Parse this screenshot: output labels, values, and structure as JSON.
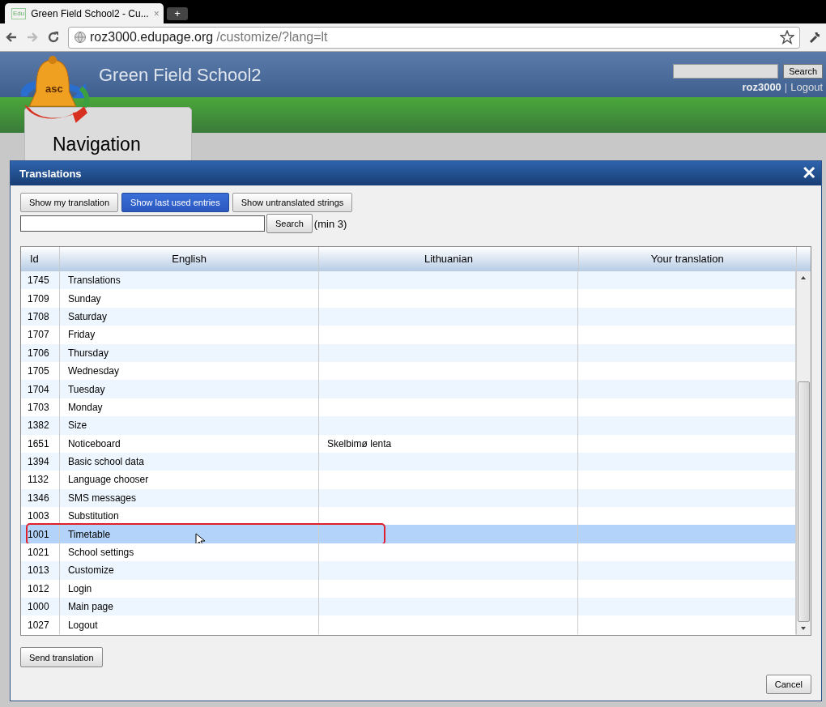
{
  "browser": {
    "tab_title": "Green Field School2 - Cu...",
    "tab_favicon": "Edu",
    "tab_close": "×",
    "new_tab": "+",
    "address_host": "roz3000.edupage.org",
    "address_path": "/customize/?lang=lt"
  },
  "site": {
    "logo_text": "asc",
    "title": "Green Field School2",
    "search_button": "Search",
    "user": "roz3000",
    "separator": "|",
    "logout": "Logout",
    "nav_tab": "Navigation"
  },
  "dialog": {
    "title": "Translations",
    "close": "✕",
    "filters": [
      {
        "label": "Show my translation",
        "selected": false
      },
      {
        "label": "Show last used entries",
        "selected": true
      },
      {
        "label": "Show untranslated strings",
        "selected": false
      }
    ],
    "search_button": "Search",
    "search_hint": "(min 3)",
    "table": {
      "columns": [
        "Id",
        "English",
        "Lithuanian",
        "Your translation"
      ],
      "rows": [
        {
          "id": "1745",
          "english": "Translations",
          "lithuanian": "",
          "selected": false
        },
        {
          "id": "1709",
          "english": "Sunday",
          "lithuanian": "",
          "selected": false
        },
        {
          "id": "1708",
          "english": "Saturday",
          "lithuanian": "",
          "selected": false
        },
        {
          "id": "1707",
          "english": "Friday",
          "lithuanian": "",
          "selected": false
        },
        {
          "id": "1706",
          "english": "Thursday",
          "lithuanian": "",
          "selected": false
        },
        {
          "id": "1705",
          "english": "Wednesday",
          "lithuanian": "",
          "selected": false
        },
        {
          "id": "1704",
          "english": "Tuesday",
          "lithuanian": "",
          "selected": false
        },
        {
          "id": "1703",
          "english": "Monday",
          "lithuanian": "",
          "selected": false
        },
        {
          "id": "1382",
          "english": "Size",
          "lithuanian": "",
          "selected": false
        },
        {
          "id": "1651",
          "english": "Noticeboard",
          "lithuanian": "Skelbimø lenta",
          "selected": false
        },
        {
          "id": "1394",
          "english": "Basic school data",
          "lithuanian": "",
          "selected": false
        },
        {
          "id": "1132",
          "english": "Language chooser",
          "lithuanian": "",
          "selected": false
        },
        {
          "id": "1346",
          "english": "SMS messages",
          "lithuanian": "",
          "selected": false
        },
        {
          "id": "1003",
          "english": "Substitution",
          "lithuanian": "",
          "selected": false
        },
        {
          "id": "1001",
          "english": "Timetable",
          "lithuanian": "",
          "selected": true
        },
        {
          "id": "1021",
          "english": "School settings",
          "lithuanian": "",
          "selected": false
        },
        {
          "id": "1013",
          "english": "Customize",
          "lithuanian": "",
          "selected": false
        },
        {
          "id": "1012",
          "english": "Login",
          "lithuanian": "",
          "selected": false
        },
        {
          "id": "1000",
          "english": "Main page",
          "lithuanian": "",
          "selected": false
        },
        {
          "id": "1027",
          "english": "Logout",
          "lithuanian": "",
          "selected": false
        }
      ]
    },
    "send_button": "Send translation",
    "cancel_button": "Cancel"
  }
}
